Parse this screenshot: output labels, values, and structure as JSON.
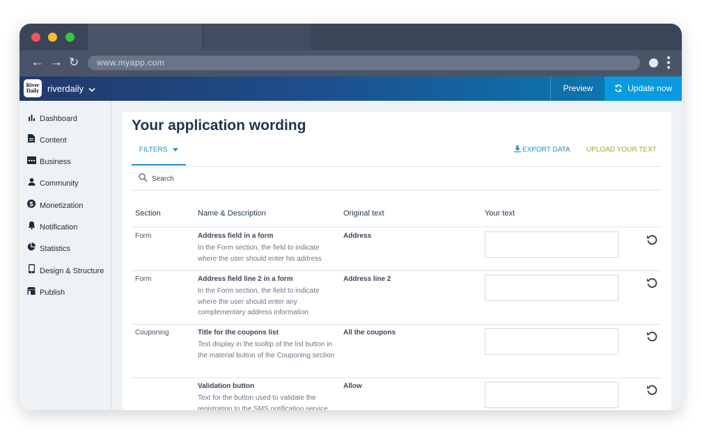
{
  "browser": {
    "url": "www.myapp.com"
  },
  "app": {
    "logo_line1": "River",
    "logo_line2": "Daily",
    "name": "riverdaily",
    "preview_label": "Preview",
    "update_label": "Update now"
  },
  "sidebar": {
    "items": [
      {
        "label": "Dashboard",
        "icon": "bar-chart-icon"
      },
      {
        "label": "Content",
        "icon": "document-icon"
      },
      {
        "label": "Business",
        "icon": "storefront-icon"
      },
      {
        "label": "Community",
        "icon": "user-icon"
      },
      {
        "label": "Monetization",
        "icon": "dollar-icon"
      },
      {
        "label": "Notification",
        "icon": "bell-icon"
      },
      {
        "label": "Statistics",
        "icon": "pie-chart-icon"
      },
      {
        "label": "Design & Structure",
        "icon": "phone-icon"
      },
      {
        "label": "Publish",
        "icon": "shop-icon"
      }
    ]
  },
  "main": {
    "title": "Your application wording",
    "filters_label": "FILTERS",
    "export_label": "EXPORT DATA",
    "upload_label": "UPLOAD YOUR TEXT",
    "search_placeholder": "Search",
    "table": {
      "headers": [
        "Section",
        "Name & Description",
        "Original text",
        "Your text"
      ],
      "rows": [
        {
          "section": "Form",
          "name": "Address field in a form",
          "description": "In the Form section, the field to indicate where the user should enter his address",
          "original": "Address",
          "your_text": ""
        },
        {
          "section": "Form",
          "name": "Address field line 2 in a form",
          "description": "In the Form section, the field to indicate where the user should enter any complementary address information",
          "original": "Address line 2",
          "your_text": ""
        },
        {
          "section": "Couponing",
          "name": "Title for the coupons list",
          "description": "Text display in the tooltip of the list button in the material button of the Couponing section",
          "original": "All the coupons",
          "your_text": ""
        },
        {
          "section": "",
          "name": "Validation button",
          "description": "Text for the button used to validate the registration to the SMS notification service",
          "original": "Allow",
          "your_text": ""
        }
      ]
    }
  },
  "colors": {
    "accent": "#1e8fd0",
    "upload": "#8bb724",
    "title": "#1d3550",
    "update_button": "#0a9ae0"
  }
}
